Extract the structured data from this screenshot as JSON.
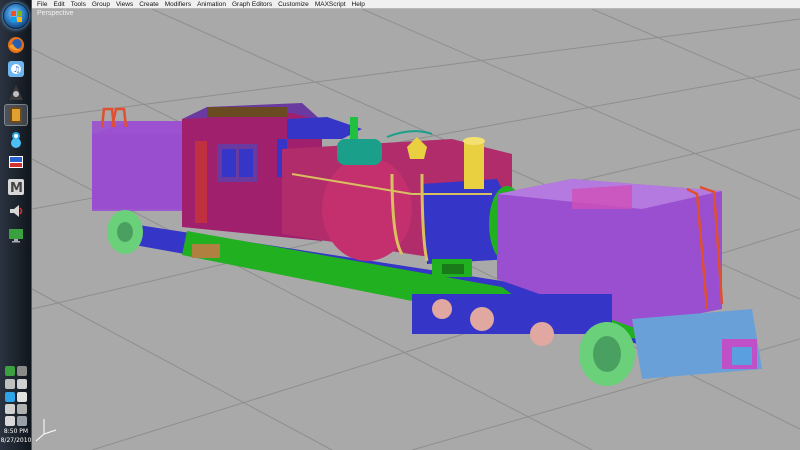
{
  "menubar": {
    "items": [
      "File",
      "Edit",
      "Tools",
      "Group",
      "Views",
      "Create",
      "Modifiers",
      "Animation",
      "Graph Editors",
      "Customize",
      "MAXScript",
      "Help"
    ]
  },
  "viewport": {
    "label": "Perspective",
    "background": "#a9a9a9"
  },
  "taskbar": {
    "pinned_icons": [
      "firefox-icon",
      "itunes-icon",
      "game-icon",
      "warcraft-icon",
      "messenger-icon",
      "display-settings-icon",
      "3dsmax-icon",
      "speaker-icon",
      "monitor-icon"
    ],
    "clock_time": "8:50 PM",
    "clock_date": "8/27/2010"
  },
  "colors": {
    "cab_magenta": "#a0206e",
    "tank_purple": "#9a4fd0",
    "boiler_blue": "#3535c8",
    "chassis_green": "#20b020",
    "wheel_green": "#6ad07a",
    "dome_yellow": "#e8d040",
    "steam_dome_teal": "#1aa08a"
  }
}
